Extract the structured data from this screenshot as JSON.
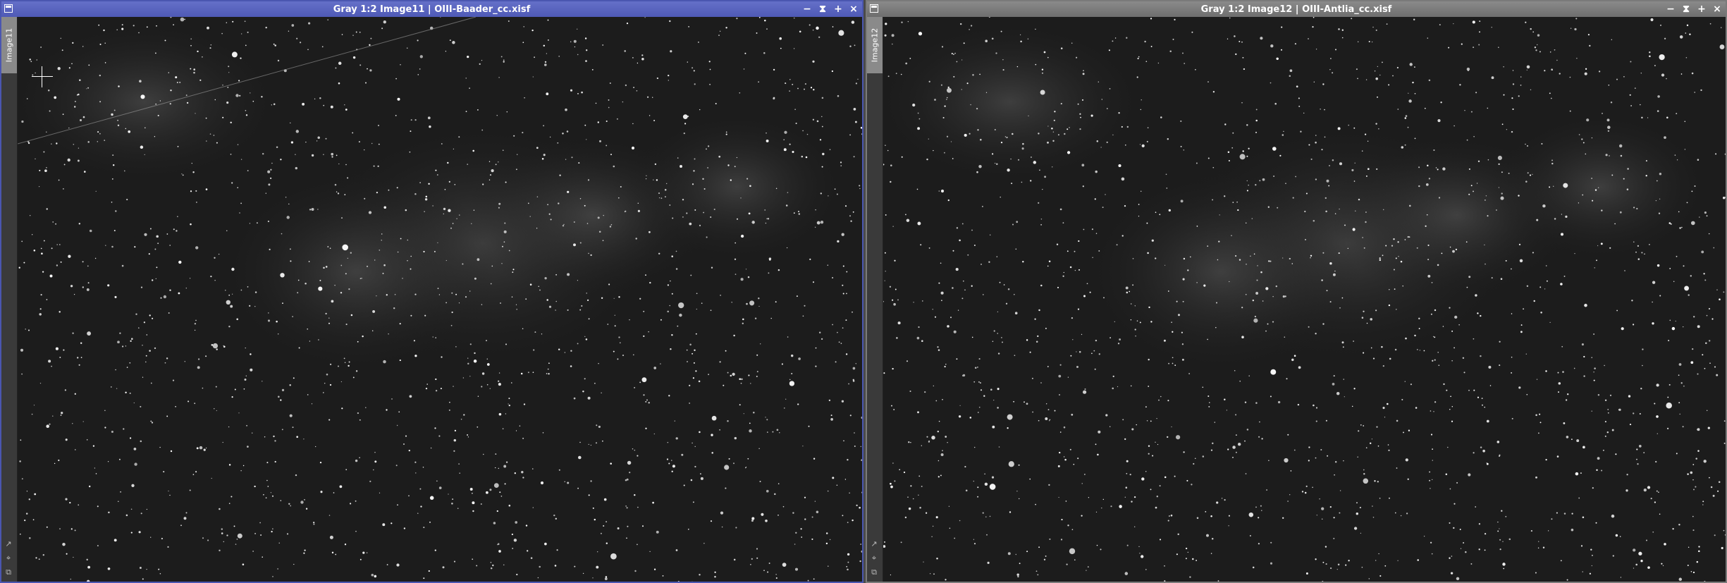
{
  "windows": [
    {
      "title": "Gray 1:2 Image11 | OIII-Baader_cc.xisf",
      "side_tab": "Image11",
      "active": true,
      "accent": "#4f5ab6"
    },
    {
      "title": "Gray 1:2 Image12 | OIII-Antlia_cc.xisf",
      "side_tab": "Image12",
      "active": false,
      "accent": "#7a7a7a"
    }
  ],
  "controls": {
    "minimize": "−",
    "shade": "⧗",
    "maximize": "+",
    "close": "×"
  },
  "side_icons": [
    "expand-icon",
    "pin-icon",
    "copy-icon"
  ]
}
